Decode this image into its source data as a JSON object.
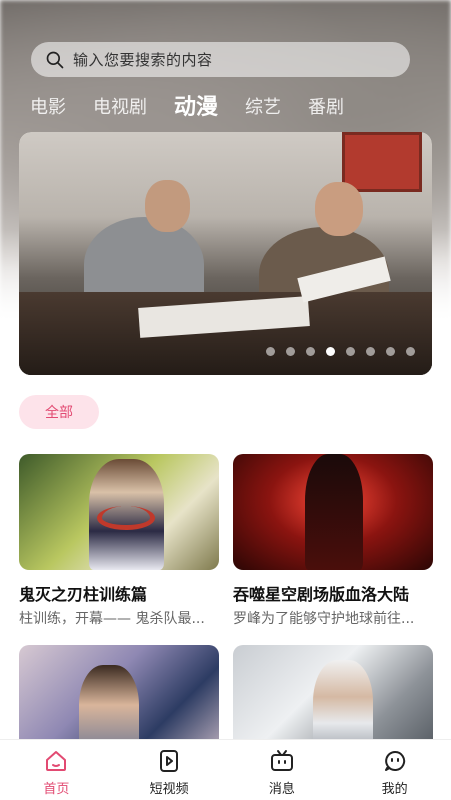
{
  "search": {
    "placeholder": "输入您要搜索的内容"
  },
  "category_tabs": [
    {
      "label": "电影",
      "active": false
    },
    {
      "label": "电视剧",
      "active": false
    },
    {
      "label": "动漫",
      "active": true
    },
    {
      "label": "综艺",
      "active": false
    },
    {
      "label": "番剧",
      "active": false
    }
  ],
  "banner": {
    "dot_count": 8,
    "active_dot": 4
  },
  "filter": {
    "label": "全部"
  },
  "cards": [
    {
      "title": "鬼灭之刃柱训练篇",
      "description": "柱训练，开幕—— 鬼杀队最..."
    },
    {
      "title": "吞噬星空剧场版血洛大陆",
      "description": "罗峰为了能够守护地球前往..."
    },
    {
      "title": "",
      "description": ""
    },
    {
      "title": "",
      "description": ""
    }
  ],
  "bottom_nav": [
    {
      "label": "首页",
      "icon": "home-icon",
      "active": true
    },
    {
      "label": "短视频",
      "icon": "play-icon",
      "active": false
    },
    {
      "label": "消息",
      "icon": "tv-icon",
      "active": false
    },
    {
      "label": "我的",
      "icon": "face-icon",
      "active": false
    }
  ],
  "colors": {
    "accent": "#e24a72",
    "accent_bg": "#fde3ea"
  }
}
